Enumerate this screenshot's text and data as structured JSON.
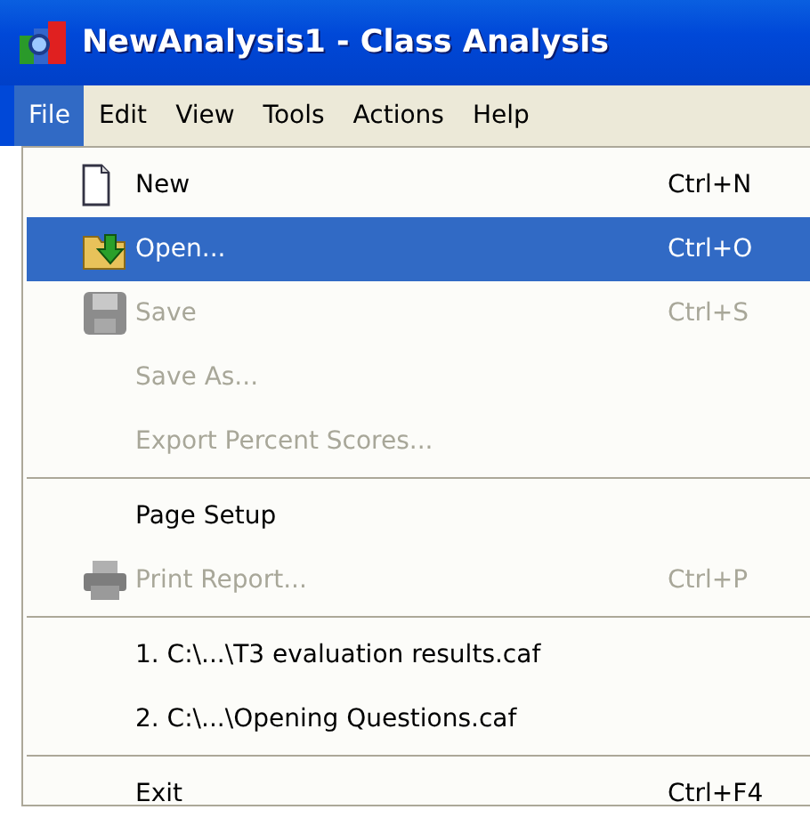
{
  "window": {
    "title": "NewAnalysis1 - Class Analysis"
  },
  "menu_bar": [
    {
      "label": "File",
      "selected": true
    },
    {
      "label": "Edit",
      "selected": false
    },
    {
      "label": "View",
      "selected": false
    },
    {
      "label": "Tools",
      "selected": false
    },
    {
      "label": "Actions",
      "selected": false
    },
    {
      "label": "Help",
      "selected": false
    }
  ],
  "file_menu": [
    {
      "kind": "item",
      "label": "New",
      "shortcut": "Ctrl+N",
      "disabled": false,
      "selected": false
    },
    {
      "kind": "item",
      "label": "Open...",
      "shortcut": "Ctrl+O",
      "disabled": false,
      "selected": true
    },
    {
      "kind": "item",
      "label": "Save",
      "shortcut": "Ctrl+S",
      "disabled": true,
      "selected": false
    },
    {
      "kind": "item",
      "label": "Save As...",
      "disabled": true,
      "selected": false
    },
    {
      "kind": "item",
      "label": "Export Percent Scores...",
      "disabled": true,
      "selected": false
    },
    {
      "kind": "separator"
    },
    {
      "kind": "item",
      "label": "Page Setup",
      "disabled": false,
      "selected": false
    },
    {
      "kind": "item",
      "label": "Print Report...",
      "shortcut": "Ctrl+P",
      "disabled": true,
      "selected": false
    },
    {
      "kind": "separator"
    },
    {
      "kind": "item",
      "label": "1. C:\\...\\T3 evaluation results.caf",
      "disabled": false,
      "selected": false
    },
    {
      "kind": "item",
      "label": "2. C:\\...\\Opening Questions.caf",
      "disabled": false,
      "selected": false
    },
    {
      "kind": "separator"
    },
    {
      "kind": "item",
      "label": "Exit",
      "shortcut": "Ctrl+F4",
      "disabled": false,
      "selected": false
    }
  ]
}
